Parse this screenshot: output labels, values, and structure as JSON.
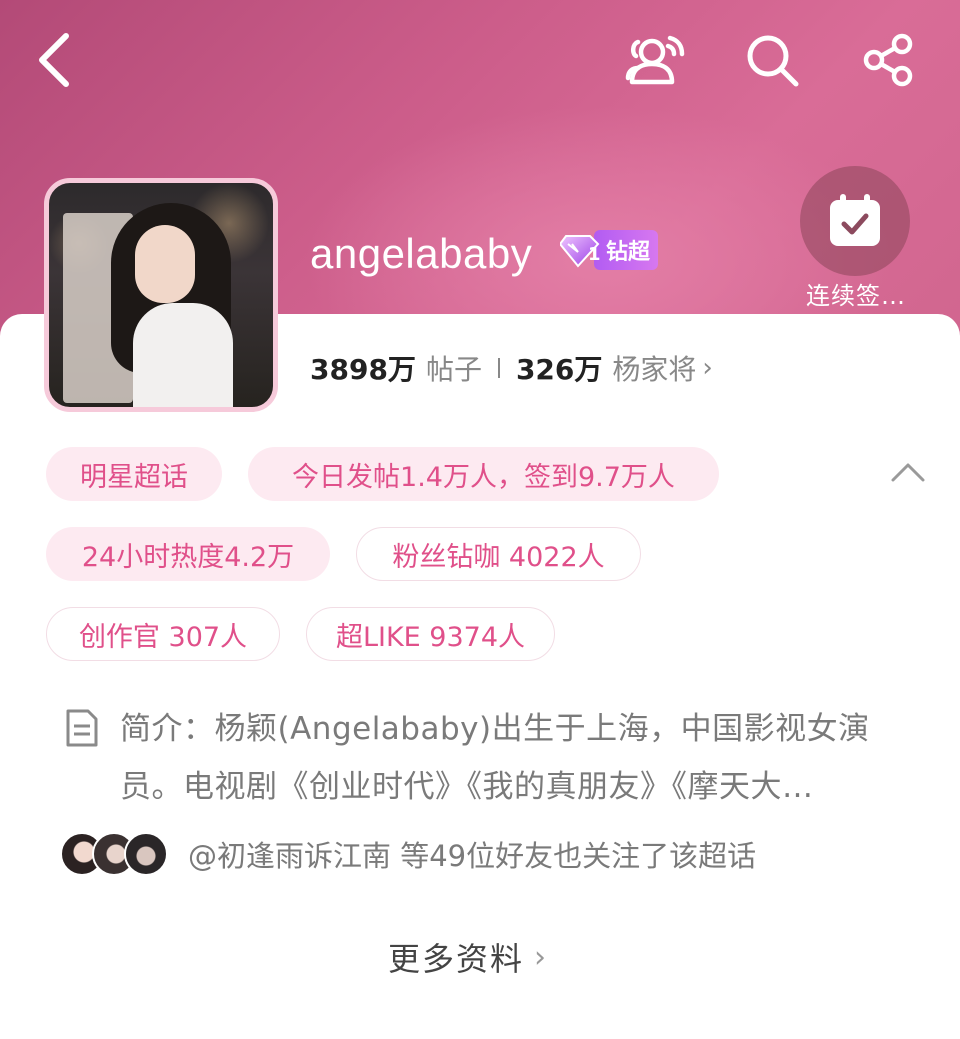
{
  "colors": {
    "header_accent": "#c4588a",
    "tag_text": "#e0508a",
    "tag_fill": "#fdeaf1",
    "badge_purple": "#b25cf2"
  },
  "topbar": {
    "back_icon": "chevron-left-icon",
    "group_icon": "group-icon",
    "search_icon": "search-icon",
    "share_icon": "share-icon"
  },
  "profile": {
    "name": "angelababy",
    "badge_level": "1",
    "badge_label": "钻超",
    "checkin_icon": "calendar-check-icon",
    "checkin_label": "连续签…"
  },
  "stats": {
    "posts_count": "3898万",
    "posts_label": "帖子",
    "fans_count": "326万",
    "fans_label": "杨家将",
    "fans_chevron": "›"
  },
  "tags": [
    {
      "label": "明星超话"
    },
    {
      "label": "今日发帖1.4万人，签到9.7万人"
    },
    {
      "label": "24小时热度4.2万"
    },
    {
      "label": "粉丝钻咖 4022人"
    },
    {
      "label": "创作官 307人"
    },
    {
      "label": "超LIKE 9374人"
    }
  ],
  "intro": {
    "icon": "document-icon",
    "text": "简介：杨颖(Angelababy)出生于上海，中国影视女演员。电视剧《创业时代》《我的真朋友》《摩天大…"
  },
  "friends": {
    "text": "@初逢雨诉江南 等49位好友也关注了该超话"
  },
  "more": {
    "label": "更多资料",
    "chevron": "›"
  }
}
